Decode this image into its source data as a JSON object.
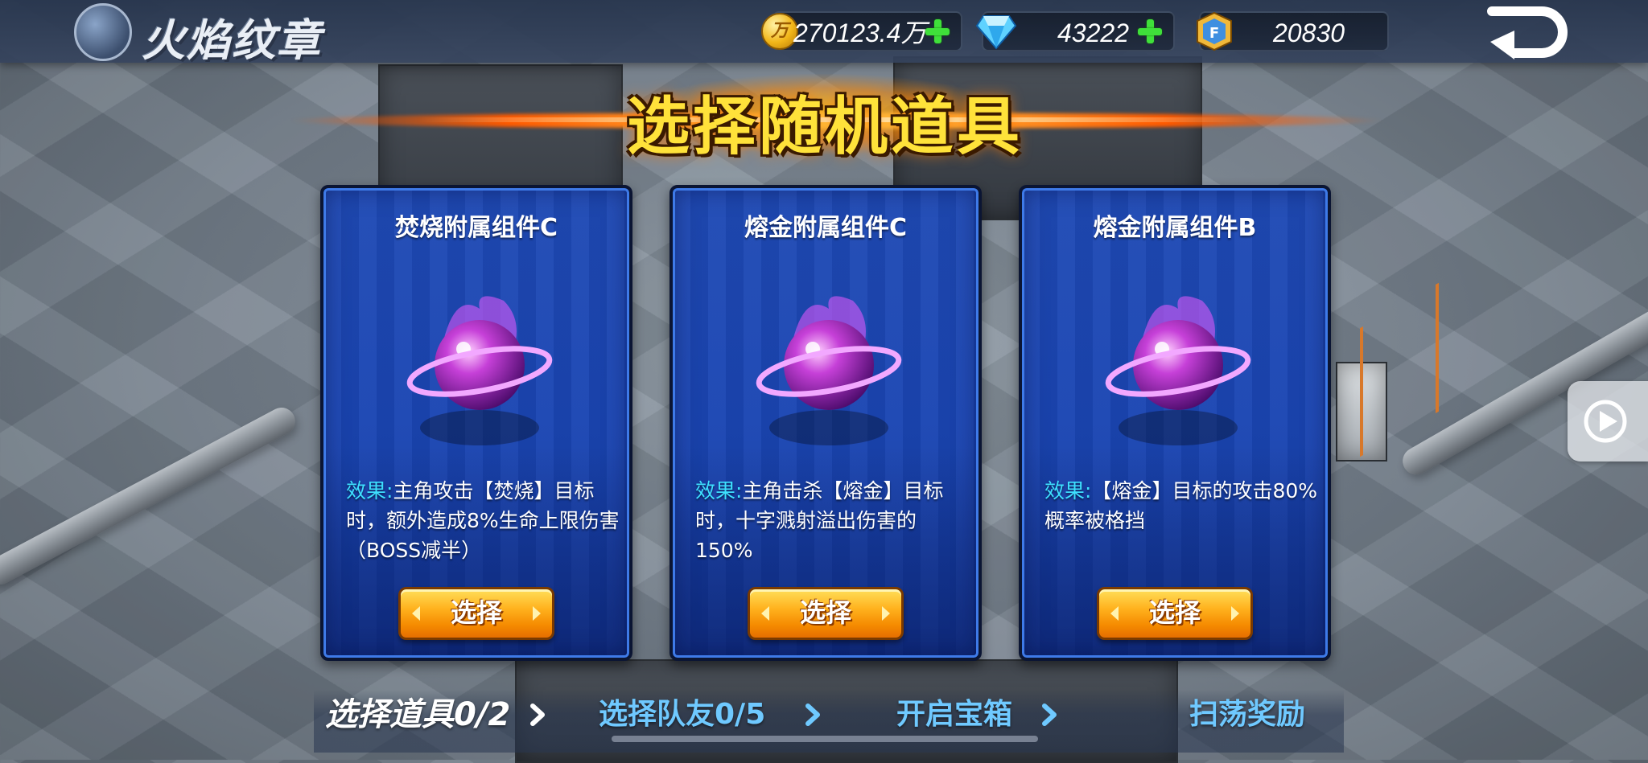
{
  "game": {
    "title": "火焰纹章"
  },
  "resources": {
    "gold": {
      "value": "270123.4万",
      "icon": "gold-coin-icon"
    },
    "diamonds": {
      "value": "43222",
      "icon": "diamond-icon"
    },
    "badges": {
      "value": "20830",
      "icon": "badge-icon"
    }
  },
  "page": {
    "title": "选择随机道具"
  },
  "cards": [
    {
      "name": "焚烧附属组件C",
      "effect_label": "效果:",
      "effect_text": "主角攻击【焚烧】目标时，额外造成8%生命上限伤害（BOSS减半）",
      "button_label": "选择"
    },
    {
      "name": "熔金附属组件C",
      "effect_label": "效果:",
      "effect_text": "主角击杀【熔金】目标时，十字溅射溢出伤害的150%",
      "button_label": "选择"
    },
    {
      "name": "熔金附属组件B",
      "effect_label": "效果:",
      "effect_text": "【熔金】目标的攻击80%概率被格挡",
      "button_label": "选择"
    }
  ],
  "steps": [
    {
      "label": "选择道具0/2",
      "active": true
    },
    {
      "label": "选择队友0/5",
      "active": false
    },
    {
      "label": "开启宝箱",
      "active": false
    },
    {
      "label": "扫荡奖励",
      "active": false
    }
  ],
  "colors": {
    "accent_gold": "#ffe23a",
    "effect_label": "#3ee0ff",
    "step_inactive": "#6fc9ff",
    "plus_green": "#3fe03a"
  }
}
